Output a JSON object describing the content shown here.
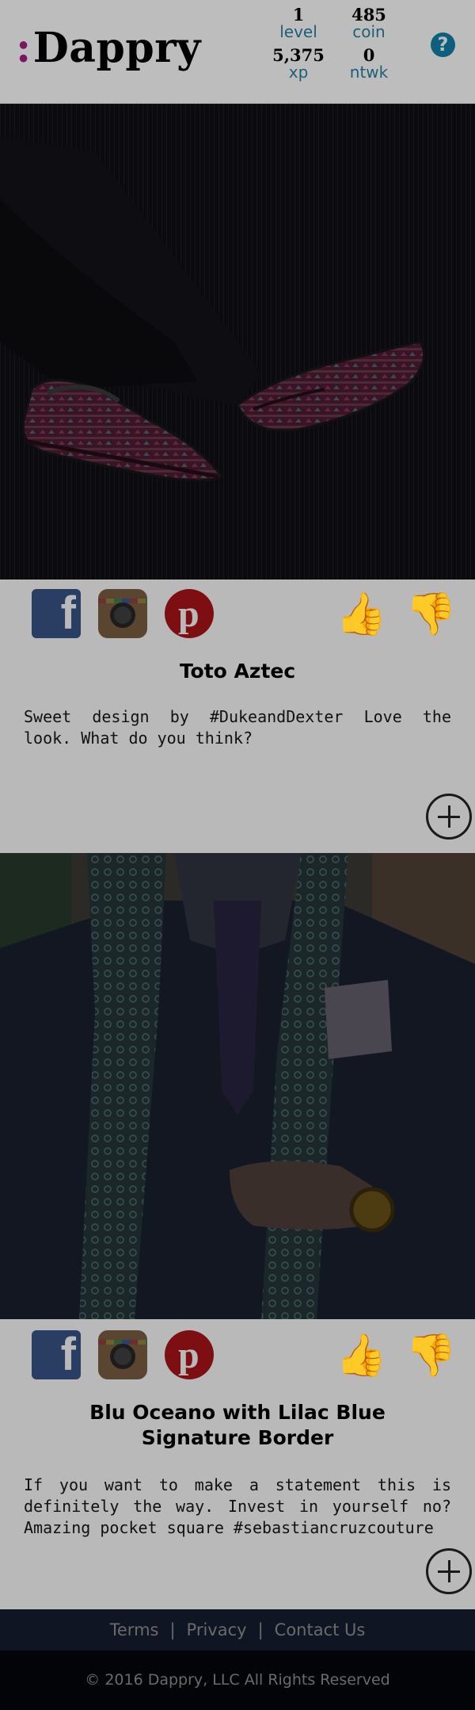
{
  "header": {
    "logo_colon": ":",
    "logo_text": "Dappry",
    "stats": {
      "level": {
        "value": "1",
        "label": "level"
      },
      "coin": {
        "value": "485",
        "label": "coin"
      },
      "xp": {
        "value": "5,375",
        "label": "xp"
      },
      "ntwk": {
        "value": "0",
        "label": "ntwk"
      }
    },
    "help_glyph": "?"
  },
  "posts": [
    {
      "title": "Toto Aztec",
      "description": "Sweet design by #DukeandDexter Love the look. What do you think?",
      "image_icon": "shoe-photo"
    },
    {
      "title": "Blu Oceano with Lilac Blue Signature Border",
      "description": "If you want to make a statement this is definitely the way. Invest in yourself no? Amazing pocket square #sebastiancruzcouture",
      "image_icon": "scarf-photo"
    }
  ],
  "social": {
    "facebook_glyph": "f",
    "pinterest_glyph": "p"
  },
  "thumbs": {
    "up": "👍",
    "down": "👎"
  },
  "footer": {
    "terms": "Terms",
    "privacy": "Privacy",
    "contact": "Contact Us",
    "separator": "|",
    "copyright": "© 2016 Dappry, LLC All Rights Reserved"
  }
}
